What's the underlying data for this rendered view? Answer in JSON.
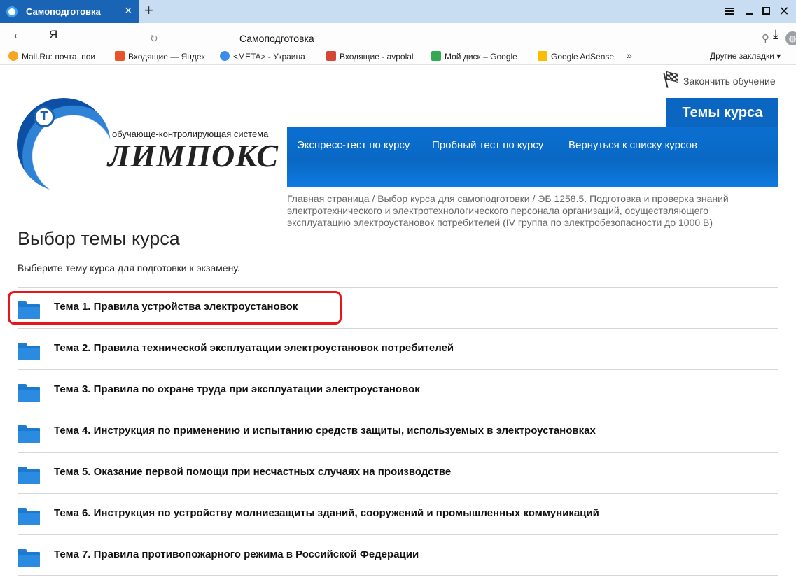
{
  "browser": {
    "tab": {
      "title": "Самоподготовка"
    },
    "address": {
      "text": "Самоподготовка"
    },
    "yandex_label": "Я",
    "bookmarks": [
      {
        "label": "Mail.Ru: почта, пои",
        "icon": "mailru-icon",
        "color": "#f5a623"
      },
      {
        "label": "Входящие — Яндек",
        "icon": "mail-icon",
        "color": "#e8532c"
      },
      {
        "label": "<META> - Украина",
        "icon": "meta-icon",
        "color": "#3a8ee6"
      },
      {
        "label": "Входящие - avpolal",
        "icon": "gmail-icon",
        "color": "#d44638"
      },
      {
        "label": "Мой диск – Google",
        "icon": "google-drive-icon",
        "color": "#34a853"
      },
      {
        "label": "Google AdSense",
        "icon": "adsense-icon",
        "color": "#fbbc05"
      }
    ],
    "bookmarks_more": "»",
    "other_bookmarks": "Другие закладки ▾"
  },
  "header": {
    "finish_label": "Закончить обучение",
    "logo": {
      "letter": "Т",
      "subtitle": "обучающе-контролирующая система",
      "name": "ЛИМПОКС"
    },
    "topics_tab": "Темы курса",
    "nav": [
      "Экспресс-тест по курсу",
      "Пробный тест по курсу",
      "Вернуться к списку курсов"
    ]
  },
  "breadcrumb": {
    "home": "Главная страница",
    "sep1": "/",
    "course_choice": "Выбор курса для самоподготовки",
    "sep2": "/",
    "current": "ЭБ 1258.5. Подготовка и проверка знаний электротехнического и электротехнологического персонала организаций, осуществляющего эксплуатацию электроустановок потребителей (IV группа по электробезопасности до 1000 В)"
  },
  "main": {
    "title": "Выбор темы курса",
    "intro": "Выберите тему курса для подготовки к экзамену.",
    "topics": [
      "Тема 1. Правила устройства электроустановок",
      "Тема 2. Правила технической эксплуатации электроустановок потребителей",
      "Тема 3. Правила по охране труда при эксплуатации электроустановок",
      "Тема 4. Инструкция по применению и испытанию средств защиты, используемых в электроустановках",
      "Тема 5. Оказание первой помощи при несчастных случаях на производстве",
      "Тема 6. Инструкция по устройству молниезащиты зданий, сооружений и промышленных коммуникаций",
      "Тема 7. Правила противопожарного режима в Российской Федерации"
    ]
  },
  "colors": {
    "tab_active": "#1a64b6",
    "nav_blue": "#0b66c1",
    "highlight": "#e8151a",
    "folder": "#1a7ad0"
  }
}
